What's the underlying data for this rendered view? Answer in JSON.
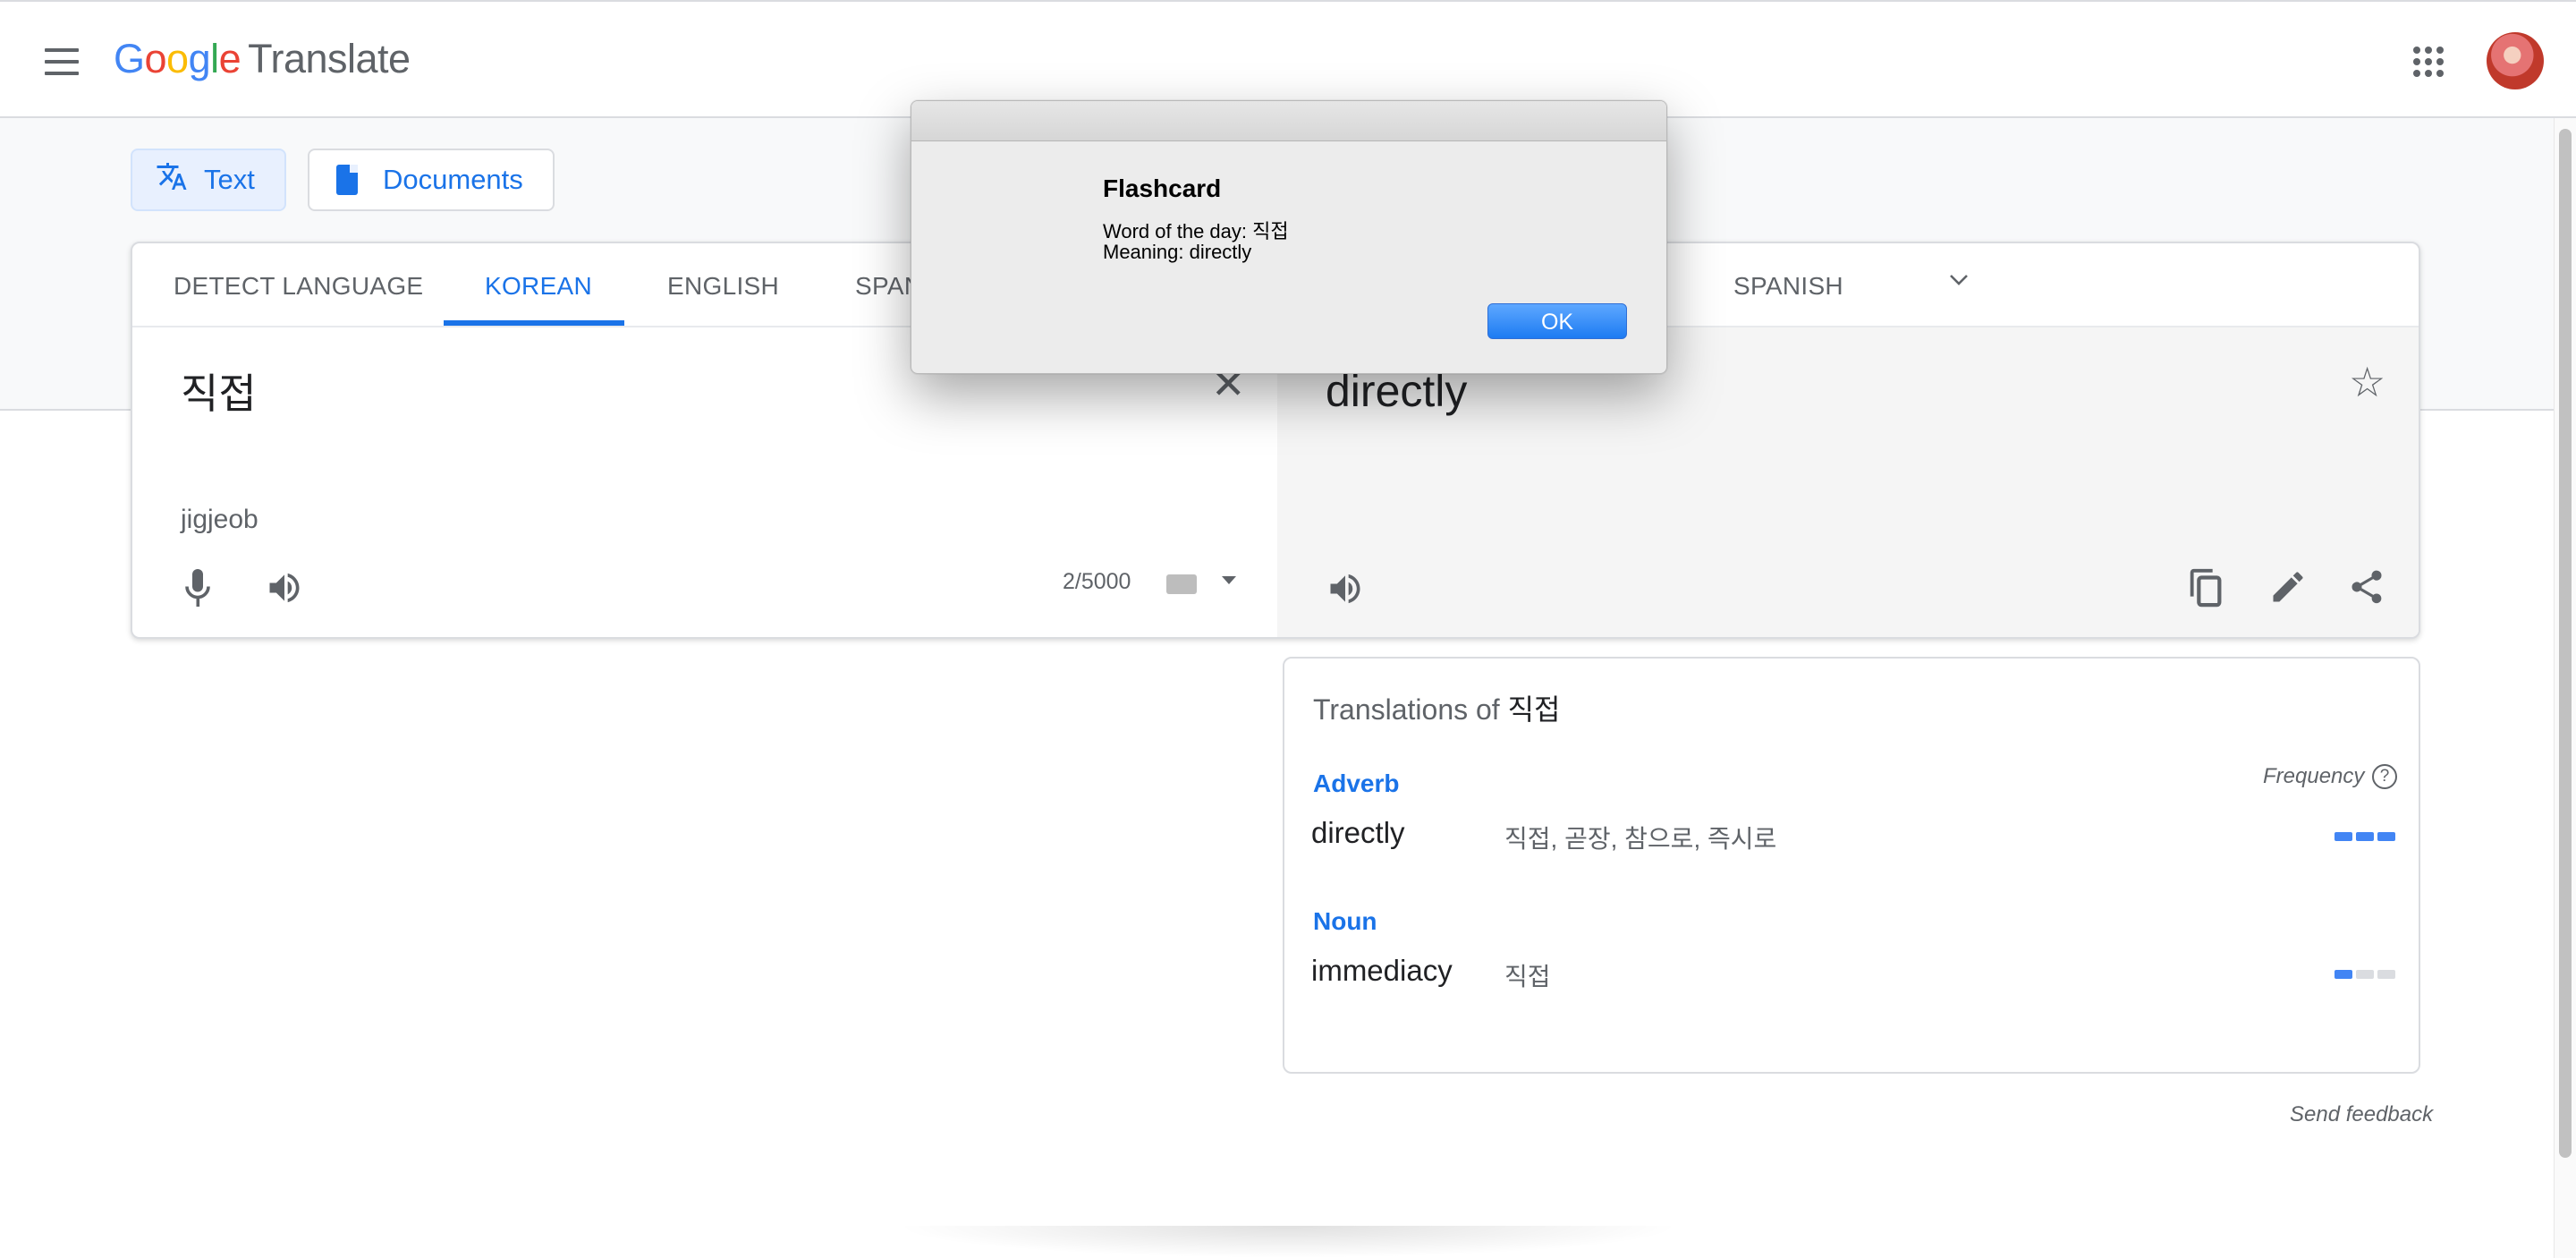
{
  "header": {
    "logo_letters": [
      "G",
      "o",
      "o",
      "g",
      "l",
      "e"
    ],
    "product": "Translate",
    "menu_icon": "hamburger-icon",
    "apps_icon": "apps-grid-icon"
  },
  "modes": {
    "text": "Text",
    "documents": "Documents"
  },
  "source_tabs": [
    "DETECT LANGUAGE",
    "KOREAN",
    "ENGLISH",
    "SPAN"
  ],
  "target_tabs": [
    "SPANISH"
  ],
  "source": {
    "text": "직접",
    "transliteration": "jigjeob",
    "counter": "2/5000"
  },
  "target": {
    "text": "directly"
  },
  "translations": {
    "title_prefix": "Translations of ",
    "title_word": "직접",
    "frequency_label": "Frequency",
    "help_glyph": "?",
    "groups": [
      {
        "pos": "Adverb",
        "word": "directly",
        "synonyms": "직접, 곧장, 참으로, 즉시로",
        "frequency": 3
      },
      {
        "pos": "Noun",
        "word": "immediacy",
        "synonyms": "직접",
        "frequency": 1
      }
    ]
  },
  "send_feedback": "Send feedback",
  "dialog": {
    "title": "Flashcard",
    "line1": "Word of the day: 직접",
    "line2": "Meaning: directly",
    "ok": "OK"
  },
  "colors": {
    "accent": "#1a73e8",
    "dialog_button": "#1d7bf2"
  }
}
